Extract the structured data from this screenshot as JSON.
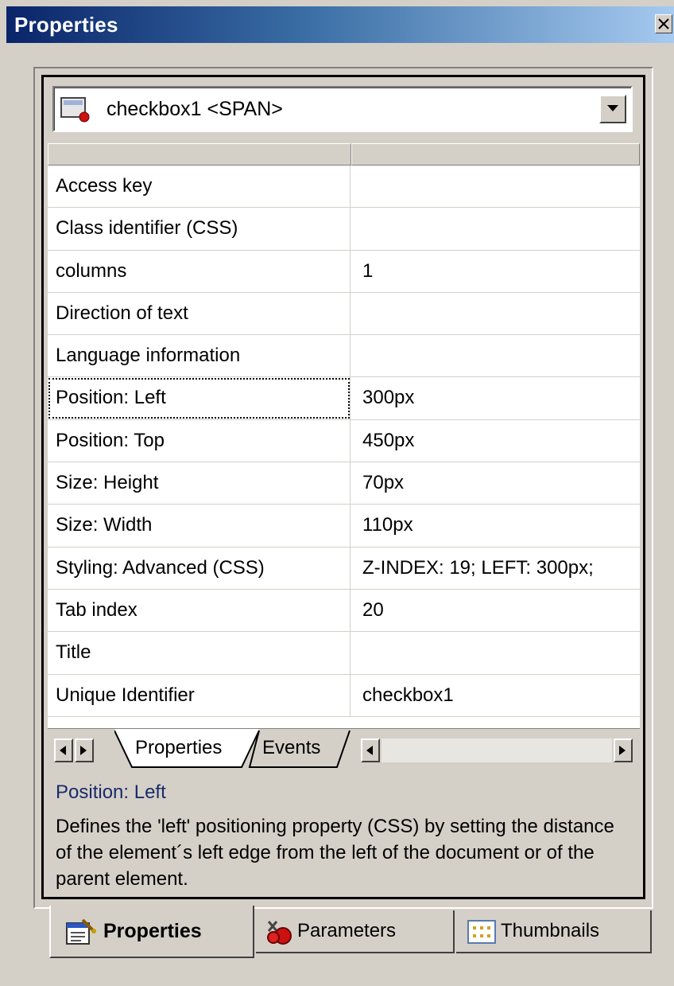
{
  "window": {
    "title": "Properties"
  },
  "object_selector": {
    "value": "checkbox1 <SPAN>"
  },
  "properties": [
    {
      "name": "Access key",
      "value": ""
    },
    {
      "name": "Class identifier (CSS)",
      "value": ""
    },
    {
      "name": "columns",
      "value": "1"
    },
    {
      "name": "Direction of text",
      "value": ""
    },
    {
      "name": "Language information",
      "value": ""
    },
    {
      "name": "Position: Left",
      "value": "300px"
    },
    {
      "name": "Position: Top",
      "value": "450px"
    },
    {
      "name": "Size: Height",
      "value": "70px"
    },
    {
      "name": "Size: Width",
      "value": "110px"
    },
    {
      "name": "Styling: Advanced (CSS)",
      "value": "Z-INDEX: 19; LEFT: 300px;"
    },
    {
      "name": "Tab index",
      "value": "20"
    },
    {
      "name": "Title",
      "value": ""
    },
    {
      "name": "Unique Identifier",
      "value": "checkbox1"
    }
  ],
  "grid_tabs": {
    "properties": "Properties",
    "events": "Events"
  },
  "description": {
    "title": "Position: Left",
    "body": "Defines the 'left' positioning property (CSS) by setting the distance of the element´s left edge from the left of the document or of the parent element."
  },
  "panel_tabs": {
    "properties": "Properties",
    "parameters": "Parameters",
    "thumbnails": "Thumbnails"
  },
  "colors": {
    "titlebar_start": "#0a246a",
    "titlebar_end": "#a6caf0",
    "description_title": "#1a2a6a"
  }
}
